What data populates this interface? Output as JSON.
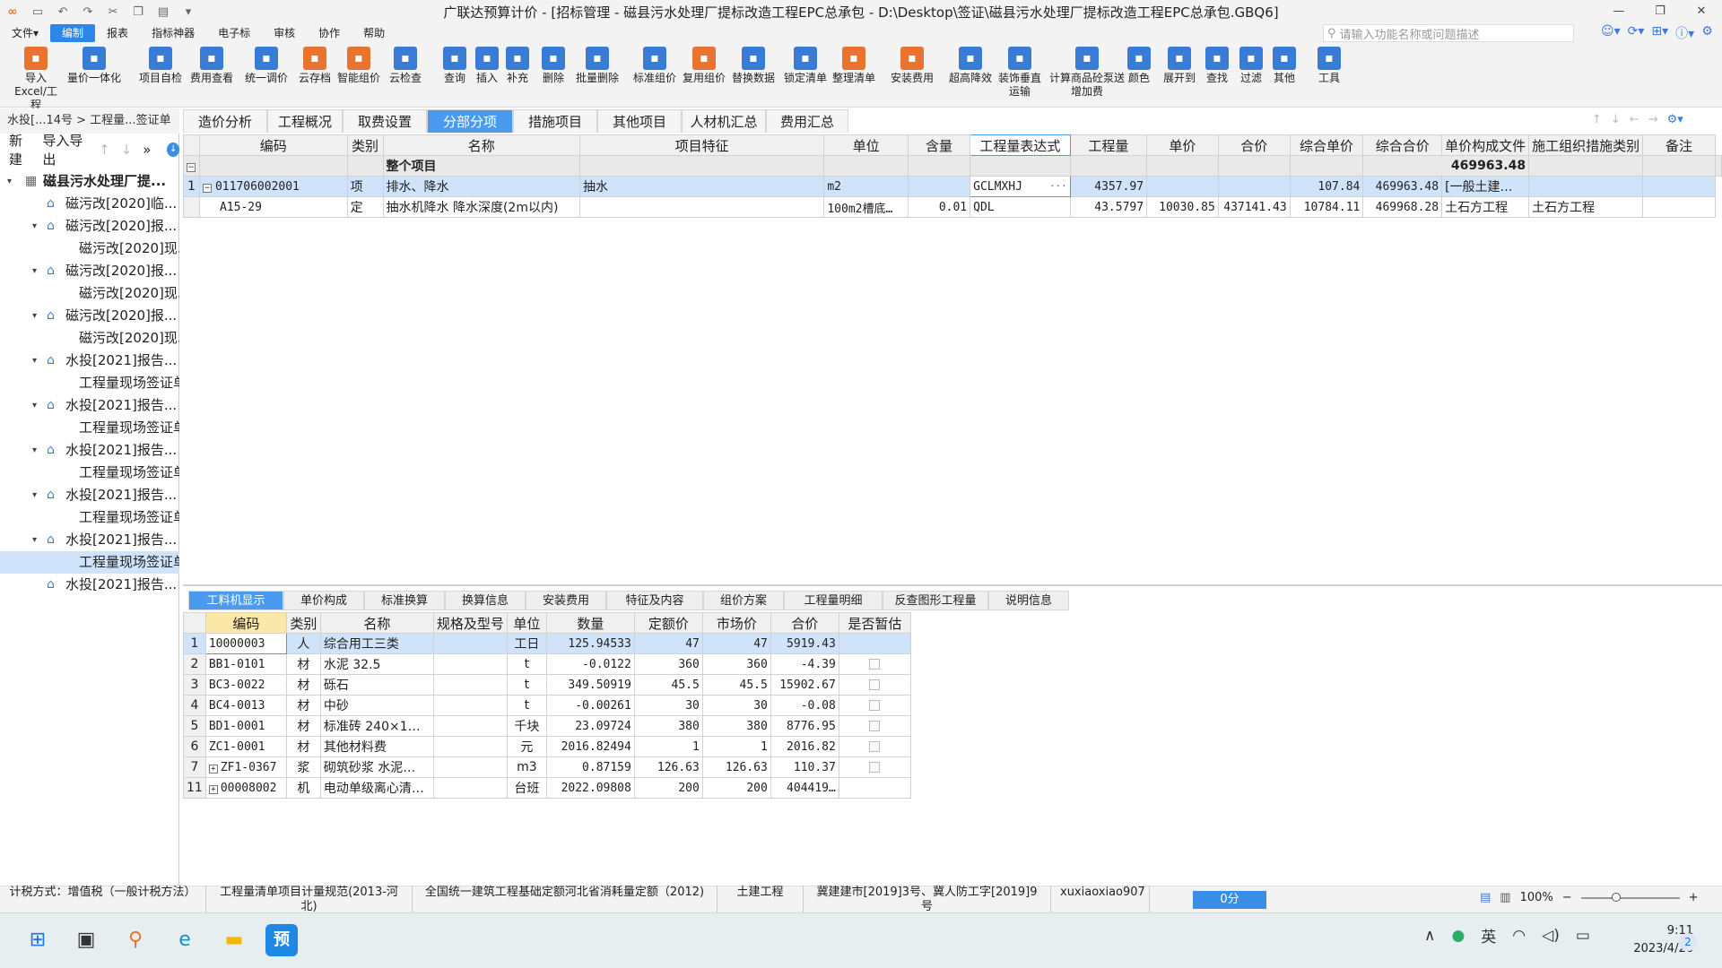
{
  "titlebar": {
    "title": "广联达预算计价 - [招标管理 - 磁县污水处理厂提标改造工程EPC总承包 - D:\\Desktop\\签证\\磁县污水处理厂提标改造工程EPC总承包.GBQ6]"
  },
  "menu": [
    "文件▾",
    "编制",
    "报表",
    "指标神器",
    "电子标",
    "审核",
    "协作",
    "帮助"
  ],
  "search": {
    "placeholder": "请输入功能名称或问题描述"
  },
  "toolbar": [
    {
      "label": "导入Excel/工程",
      "icon": "import-excel-icon",
      "color": "#e8742f"
    },
    {
      "label": "量价一体化",
      "icon": "integration-icon",
      "color": "#3a7bd5"
    },
    {
      "label": "项目自检",
      "icon": "self-check-icon",
      "color": "#3a7bd5"
    },
    {
      "label": "费用查看",
      "icon": "cost-view-icon",
      "color": "#3a7bd5"
    },
    {
      "label": "统一调价",
      "icon": "price-adjust-icon",
      "color": "#3a7bd5"
    },
    {
      "label": "云存档",
      "icon": "cloud-save-icon",
      "color": "#e8742f"
    },
    {
      "label": "智能组价",
      "icon": "smart-price-icon",
      "color": "#e8742f"
    },
    {
      "label": "云检查",
      "icon": "cloud-check-icon",
      "color": "#3a7bd5"
    },
    {
      "label": "查询",
      "icon": "query-icon",
      "color": "#3a7bd5"
    },
    {
      "label": "插入",
      "icon": "insert-icon",
      "color": "#3a7bd5"
    },
    {
      "label": "补充",
      "icon": "supplement-icon",
      "color": "#3a7bd5"
    },
    {
      "label": "删除",
      "icon": "delete-icon",
      "color": "#3a7bd5"
    },
    {
      "label": "批量删除",
      "icon": "batch-delete-icon",
      "color": "#3a7bd5"
    },
    {
      "label": "标准组价",
      "icon": "standard-price-icon",
      "color": "#3a7bd5"
    },
    {
      "label": "复用组价",
      "icon": "reuse-price-icon",
      "color": "#e8742f"
    },
    {
      "label": "替换数据",
      "icon": "replace-data-icon",
      "color": "#3a7bd5"
    },
    {
      "label": "锁定清单",
      "icon": "lock-icon",
      "color": "#3a7bd5"
    },
    {
      "label": "整理清单",
      "icon": "organize-list-icon",
      "color": "#e8742f"
    },
    {
      "label": "安装费用",
      "icon": "install-cost-icon",
      "color": "#e8742f"
    },
    {
      "label": "超高降效",
      "icon": "height-efficiency-icon",
      "color": "#3a7bd5"
    },
    {
      "label": "装饰垂直运输",
      "icon": "vertical-transport-icon",
      "color": "#3a7bd5"
    },
    {
      "label": "计算商品砼泵送增加费",
      "icon": "concrete-pump-icon",
      "color": "#3a7bd5"
    },
    {
      "label": "颜色",
      "icon": "color-icon",
      "color": "#3a7bd5"
    },
    {
      "label": "展开到",
      "icon": "expand-icon",
      "color": "#3a7bd5"
    },
    {
      "label": "查找",
      "icon": "find-icon",
      "color": "#3a7bd5"
    },
    {
      "label": "过滤",
      "icon": "filter-icon",
      "color": "#3a7bd5"
    },
    {
      "label": "其他",
      "icon": "other-icon",
      "color": "#3a7bd5"
    },
    {
      "label": "工具",
      "icon": "tools-icon",
      "color": "#3a7bd5"
    }
  ],
  "left": {
    "breadcrumb": "水投[...14号 > 工程量...签证单",
    "actions": {
      "new": "新建",
      "import_export": "导入导出",
      "more": "»"
    },
    "tree": [
      {
        "label": "磁县污水处理厂提...",
        "level": 0,
        "expanded": true,
        "bold": true
      },
      {
        "label": "磁污改[2020]临...",
        "level": 1,
        "home": true
      },
      {
        "label": "磁污改[2020]报...",
        "level": 1,
        "home": true,
        "expanded": true
      },
      {
        "label": "磁污改[2020]现...",
        "level": 2
      },
      {
        "label": "磁污改[2020]报...",
        "level": 1,
        "home": true,
        "expanded": true
      },
      {
        "label": "磁污改[2020]现...",
        "level": 2
      },
      {
        "label": "磁污改[2020]报...",
        "level": 1,
        "home": true,
        "expanded": true
      },
      {
        "label": "磁污改[2020]现...",
        "level": 2
      },
      {
        "label": "水投[2021]报告...",
        "level": 1,
        "home": true,
        "expanded": true
      },
      {
        "label": "工程量现场签证单",
        "level": 2
      },
      {
        "label": "水投[2021]报告...",
        "level": 1,
        "home": true,
        "expanded": true
      },
      {
        "label": "工程量现场签证单",
        "level": 2
      },
      {
        "label": "水投[2021]报告...",
        "level": 1,
        "home": true,
        "expanded": true
      },
      {
        "label": "工程量现场签证单",
        "level": 2
      },
      {
        "label": "水投[2021]报告...",
        "level": 1,
        "home": true,
        "expanded": true
      },
      {
        "label": "工程量现场签证单",
        "level": 2
      },
      {
        "label": "水投[2021]报告...",
        "level": 1,
        "home": true,
        "expanded": true
      },
      {
        "label": "工程量现场签证单",
        "level": 2,
        "selected": true
      },
      {
        "label": "水投[2021]报告...",
        "level": 1,
        "home": true
      }
    ]
  },
  "tabs": [
    "造价分析",
    "工程概况",
    "取费设置",
    "分部分项",
    "措施项目",
    "其他项目",
    "人材机汇总",
    "费用汇总"
  ],
  "active_tab": 3,
  "main_grid": {
    "headers": [
      "",
      "编码",
      "类别",
      "名称",
      "项目特征",
      "单位",
      "含量",
      "工程量表达式",
      "工程量",
      "单价",
      "合价",
      "综合单价",
      "综合合价",
      "单价构成文件",
      "施工组织措施类别",
      "备注"
    ],
    "summary": {
      "label": "整个项目",
      "total": "469963.48"
    },
    "rows": [
      {
        "no": "1",
        "code": "011706002001",
        "type": "项",
        "name": "排水、降水",
        "feature": "抽水",
        "unit": "m2",
        "content": "",
        "expr": "GCLMXHJ",
        "qty": "4357.97",
        "price": "",
        "amount": "",
        "comp_price": "107.84",
        "comp_amount": "469963.48",
        "price_file": "[一般土建…",
        "category": "",
        "note": ""
      },
      {
        "no": "",
        "code": "A15-29",
        "type": "定",
        "name": "抽水机降水 降水深度(2m以内)",
        "feature": "",
        "unit": "100m2槽底…",
        "content": "0.01",
        "expr": "QDL",
        "qty": "43.5797",
        "price": "10030.85",
        "amount": "437141.43",
        "comp_price": "10784.11",
        "comp_amount": "469968.28",
        "price_file": "土石方工程",
        "category": "土石方工程",
        "note": ""
      }
    ]
  },
  "bottom_tabs": [
    "工料机显示",
    "单价构成",
    "标准换算",
    "换算信息",
    "安装费用",
    "特征及内容",
    "组价方案",
    "工程量明细",
    "反查图形工程量",
    "说明信息"
  ],
  "active_bottom_tab": 0,
  "sub_grid": {
    "headers": [
      "",
      "编码",
      "类别",
      "名称",
      "规格及型号",
      "单位",
      "数量",
      "定额价",
      "市场价",
      "合价",
      "是否暂估"
    ],
    "rows": [
      {
        "no": "1",
        "code": "10000003",
        "type": "人",
        "name": "综合用工三类",
        "spec": "",
        "unit": "工日",
        "qty": "125.94533",
        "quota": "47",
        "market": "47",
        "amount": "5919.43",
        "expand": false,
        "check": false
      },
      {
        "no": "2",
        "code": "BB1-0101",
        "type": "材",
        "name": "水泥 32.5",
        "spec": "",
        "unit": "t",
        "qty": "-0.0122",
        "quota": "360",
        "market": "360",
        "amount": "-4.39",
        "expand": false,
        "check": true
      },
      {
        "no": "3",
        "code": "BC3-0022",
        "type": "材",
        "name": "砾石",
        "spec": "",
        "unit": "t",
        "qty": "349.50919",
        "quota": "45.5",
        "market": "45.5",
        "amount": "15902.67",
        "expand": false,
        "check": true
      },
      {
        "no": "4",
        "code": "BC4-0013",
        "type": "材",
        "name": "中砂",
        "spec": "",
        "unit": "t",
        "qty": "-0.00261",
        "quota": "30",
        "market": "30",
        "amount": "-0.08",
        "expand": false,
        "check": true
      },
      {
        "no": "5",
        "code": "BD1-0001",
        "type": "材",
        "name": "标准砖 240×1…",
        "spec": "",
        "unit": "千块",
        "qty": "23.09724",
        "quota": "380",
        "market": "380",
        "amount": "8776.95",
        "expand": false,
        "check": true
      },
      {
        "no": "6",
        "code": "ZC1-0001",
        "type": "材",
        "name": "其他材料费",
        "spec": "",
        "unit": "元",
        "qty": "2016.82494",
        "quota": "1",
        "market": "1",
        "amount": "2016.82",
        "expand": false,
        "check": true
      },
      {
        "no": "7",
        "code": "ZF1-0367",
        "type": "浆",
        "name": "砌筑砂浆 水泥…",
        "spec": "",
        "unit": "m3",
        "qty": "0.87159",
        "quota": "126.63",
        "market": "126.63",
        "amount": "110.37",
        "expand": true,
        "check": true
      },
      {
        "no": "11",
        "code": "00008002",
        "type": "机",
        "name": "电动单级离心清…",
        "spec": "",
        "unit": "台班",
        "qty": "2022.09808",
        "quota": "200",
        "market": "200",
        "amount": "404419…",
        "expand": true,
        "check": false
      }
    ]
  },
  "status": {
    "items": [
      "计税方式：增值税（一般计税方法）",
      "工程量清单项目计量规范(2013-河北)",
      "全国统一建筑工程基础定额河北省消耗量定额（2012)",
      "土建工程",
      "冀建建市[2019]3号、冀人防工字[2019]9号",
      "xuxiaoxiao907"
    ],
    "score": "0分",
    "zoom": "100%"
  },
  "taskbar": {
    "apps": [
      {
        "icon": "windows-start-icon",
        "glyph": "⊞",
        "color": "#1a73e8"
      },
      {
        "icon": "task-view-icon",
        "glyph": "▣",
        "color": "#333333"
      },
      {
        "icon": "search-app-icon",
        "glyph": "⚲",
        "color": "#e8742f"
      },
      {
        "icon": "edge-icon",
        "glyph": "e",
        "color": "#1a8fc9"
      },
      {
        "icon": "explorer-icon",
        "glyph": "▬",
        "color": "#f2b705"
      },
      {
        "icon": "glodon-app-icon",
        "glyph": "预",
        "color": "#1e88e5"
      }
    ],
    "ime": "英",
    "time": "9:11",
    "date": "2023/4/26",
    "notify": "2"
  }
}
